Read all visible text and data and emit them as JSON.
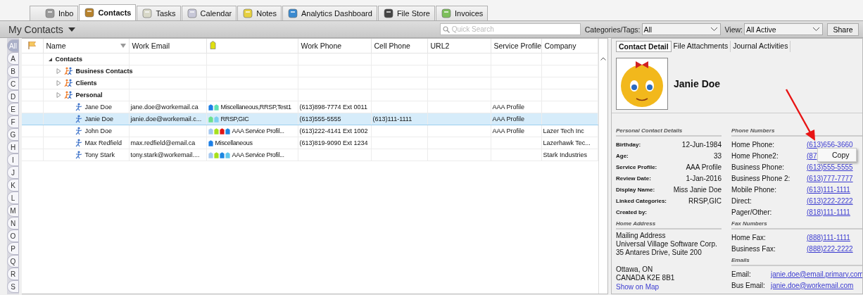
{
  "tabs": [
    {
      "label": "Inbo",
      "kind": "inbox",
      "selected": false
    },
    {
      "label": "Contacts",
      "kind": "contacts",
      "selected": true
    },
    {
      "label": "Tasks",
      "kind": "tasks",
      "selected": false
    },
    {
      "label": "Calendar",
      "kind": "calendar",
      "selected": false
    },
    {
      "label": "Notes",
      "kind": "notes",
      "selected": false
    },
    {
      "label": "Analytics Dashboard",
      "kind": "analytics",
      "selected": false
    },
    {
      "label": "File Store",
      "kind": "files",
      "selected": false
    },
    {
      "label": "Invoices",
      "kind": "invoices",
      "selected": false
    }
  ],
  "toolbar": {
    "title": "My Contacts",
    "search": {
      "placeholder": "Quick Search"
    },
    "categories": {
      "label": "Categories/Tags:",
      "value": "All"
    },
    "view": {
      "label": "View:",
      "value": "All Active"
    },
    "share": "Share"
  },
  "alphabet": [
    {
      "label": "All",
      "selected": true
    },
    {
      "label": "A",
      "selected": false
    },
    {
      "label": "B",
      "selected": false
    },
    {
      "label": "C",
      "selected": false
    },
    {
      "label": "D",
      "selected": false
    },
    {
      "label": "E",
      "selected": false
    },
    {
      "label": "F",
      "selected": false
    },
    {
      "label": "G",
      "selected": false
    },
    {
      "label": "H",
      "selected": false
    },
    {
      "label": "I",
      "selected": false
    },
    {
      "label": "J",
      "selected": false
    },
    {
      "label": "K",
      "selected": false
    },
    {
      "label": "L",
      "selected": false
    },
    {
      "label": "M",
      "selected": false
    },
    {
      "label": "N",
      "selected": false
    },
    {
      "label": "O",
      "selected": false
    },
    {
      "label": "P",
      "selected": false
    },
    {
      "label": "Q",
      "selected": false
    },
    {
      "label": "R",
      "selected": false
    },
    {
      "label": "S",
      "selected": false
    }
  ],
  "table": {
    "columns": [
      {
        "kind": "flag",
        "sorted": false
      },
      {
        "kind": "text",
        "label": "Name",
        "sorted": true
      },
      {
        "kind": "text",
        "label": "Work Email",
        "sorted": false
      },
      {
        "kind": "tag",
        "sorted": false
      },
      {
        "kind": "text",
        "label": "Work Phone",
        "sorted": false
      },
      {
        "kind": "text",
        "label": "Cell Phone",
        "sorted": false
      },
      {
        "kind": "text",
        "label": "URL2",
        "sorted": false
      },
      {
        "kind": "text",
        "label": "Service Profile",
        "sorted": false
      },
      {
        "kind": "text",
        "label": "Company",
        "sorted": false
      }
    ],
    "rows": [
      {
        "kind": "group",
        "name": "Contacts",
        "expanded": true,
        "children": [
          {
            "kind": "group",
            "name": "Business Contacts",
            "expanded": false
          },
          {
            "kind": "group",
            "name": "Clients",
            "expanded": false
          },
          {
            "kind": "group",
            "name": "Personal",
            "expanded": false
          },
          {
            "kind": "contact",
            "name": "Jane Doe",
            "selected": false,
            "work_email": "jane.doe@workemail.ca",
            "tags": [
              {
                "color": "#1c7fe6"
              },
              {
                "color": "#5ee0b4"
              }
            ],
            "categories": "Miscellaneous,RRSP,Test1",
            "work_phone": "(613)898-7774 Ext 0011",
            "service_profile": "AAA Profile"
          },
          {
            "kind": "contact",
            "name": "Janie Doe",
            "selected": true,
            "work_email": "janie.doe@workemail.c...",
            "tags": [
              {
                "color": "#6ee08e"
              },
              {
                "color": "#7fcff0"
              }
            ],
            "categories": "RRSP,GIC",
            "work_phone": "(613)555-5555",
            "cell_phone": "(613)111-1111",
            "service_profile": "AAA Profile"
          },
          {
            "kind": "contact",
            "name": "John Doe",
            "selected": false,
            "tags": [
              {
                "color": "#a4c8f0"
              },
              {
                "color": "#a6e01c"
              },
              {
                "color": "#e01414"
              },
              {
                "color": "#1c86e0"
              }
            ],
            "categories": "AAA Service Profil...",
            "work_phone": "(613)222-4141 Ext 1002",
            "service_profile": "AAA Profile",
            "company": "Lazer Tech Inc"
          },
          {
            "kind": "contact",
            "name": "Max Redfield",
            "selected": false,
            "work_email": "max.redfield@email.ca",
            "tags": [
              {
                "color": "#1c7fe6"
              }
            ],
            "categories": "Miscellaneous",
            "work_phone": "(613)819-9090 Ext 1234",
            "company": "Lazerhawk Tec..."
          },
          {
            "kind": "contact",
            "name": "Tony Stark",
            "selected": false,
            "work_email": "tony.stark@workemail....",
            "tags": [
              {
                "color": "#a4c8f0"
              },
              {
                "color": "#a6e01c"
              },
              {
                "color": "#1c86e0"
              },
              {
                "color": "#62c8ec"
              }
            ],
            "categories": "AAA Service Profil...",
            "company": "Stark Industries"
          }
        ]
      }
    ]
  },
  "detail": {
    "tabs": [
      {
        "label": "Contact Detail",
        "selected": true
      },
      {
        "label": "File Attachments",
        "selected": false
      },
      {
        "label": "Journal Activities",
        "selected": false
      }
    ],
    "name": "Janie Doe",
    "personal": {
      "title": "Personal Contact Details",
      "fields": [
        {
          "label": "Birthday:",
          "value": "12-Jun-1984"
        },
        {
          "label": "Age:",
          "value": "33"
        },
        {
          "label": "Service Profile:",
          "value": "AAA Profile"
        },
        {
          "label": "Review Date:",
          "value": "1-Jan-2016"
        },
        {
          "label": "Display Name:",
          "value": "Miss Janie Doe"
        },
        {
          "label": "Linked Categories:",
          "value": "RRSP,GIC"
        },
        {
          "label": "Created by:"
        }
      ]
    },
    "home_address": {
      "title": "Home Address",
      "lines": [
        "Mailing Address",
        "Universal Village Software Corp.",
        "35 Antares Drive, Suite 200"
      ],
      "lines_2": [
        "Ottawa, ON",
        "CANADA K2E 8B1"
      ],
      "map_link": "Show on Map"
    },
    "phones": {
      "title": "Phone Numbers",
      "fields": [
        {
          "label": "Home Phone:",
          "value": "(613)656-3660"
        },
        {
          "label": "Home Phone2:",
          "value": "(87"
        },
        {
          "label": "Business Phone:",
          "value": "(613)555-5555"
        },
        {
          "label": "Business Phone 2:",
          "value": "(613)777-7777"
        },
        {
          "label": "Mobile Phone:",
          "value": "(613)111-1111"
        },
        {
          "label": "Direct:",
          "value": "(613)222-2222"
        },
        {
          "label": "Pager/Other:",
          "value": "(818)111-1111"
        }
      ]
    },
    "fax": {
      "title": "Fax Numbers",
      "fields": [
        {
          "label": "Home Fax:",
          "value": "(888)111-1111"
        },
        {
          "label": "Business Fax:",
          "value": "(888)222-2222"
        }
      ]
    },
    "emails": {
      "title": "Emails",
      "fields": [
        {
          "label": "Email:",
          "value": "janie.doe@email.primary.com"
        },
        {
          "label": "Bus Email:",
          "value": "janie.doe@workemail.com"
        }
      ]
    }
  },
  "context_menu": {
    "items": [
      "Copy"
    ]
  }
}
